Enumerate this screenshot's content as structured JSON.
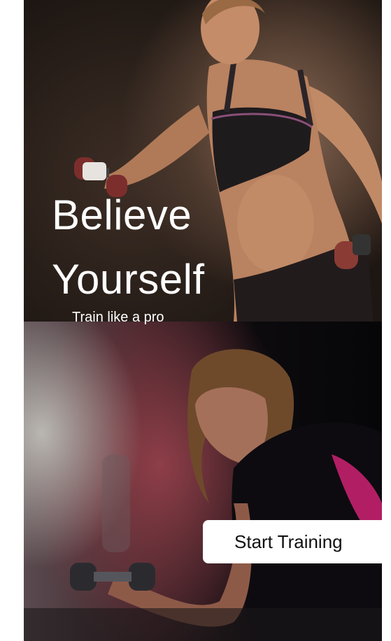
{
  "hero": {
    "title_line1": "Believe",
    "title_line2": "Yourself",
    "subtitle": "Train like a pro"
  },
  "cta": {
    "label": "Start Training"
  },
  "colors": {
    "text": "#ffffff",
    "button_bg": "#ffffff",
    "button_text": "#111111",
    "page_bg": "#ffffff"
  },
  "images": {
    "top": "fitness-woman-with-dumbbells-photo",
    "bottom": "woman-lifting-dumbbell-in-gym-photo"
  }
}
